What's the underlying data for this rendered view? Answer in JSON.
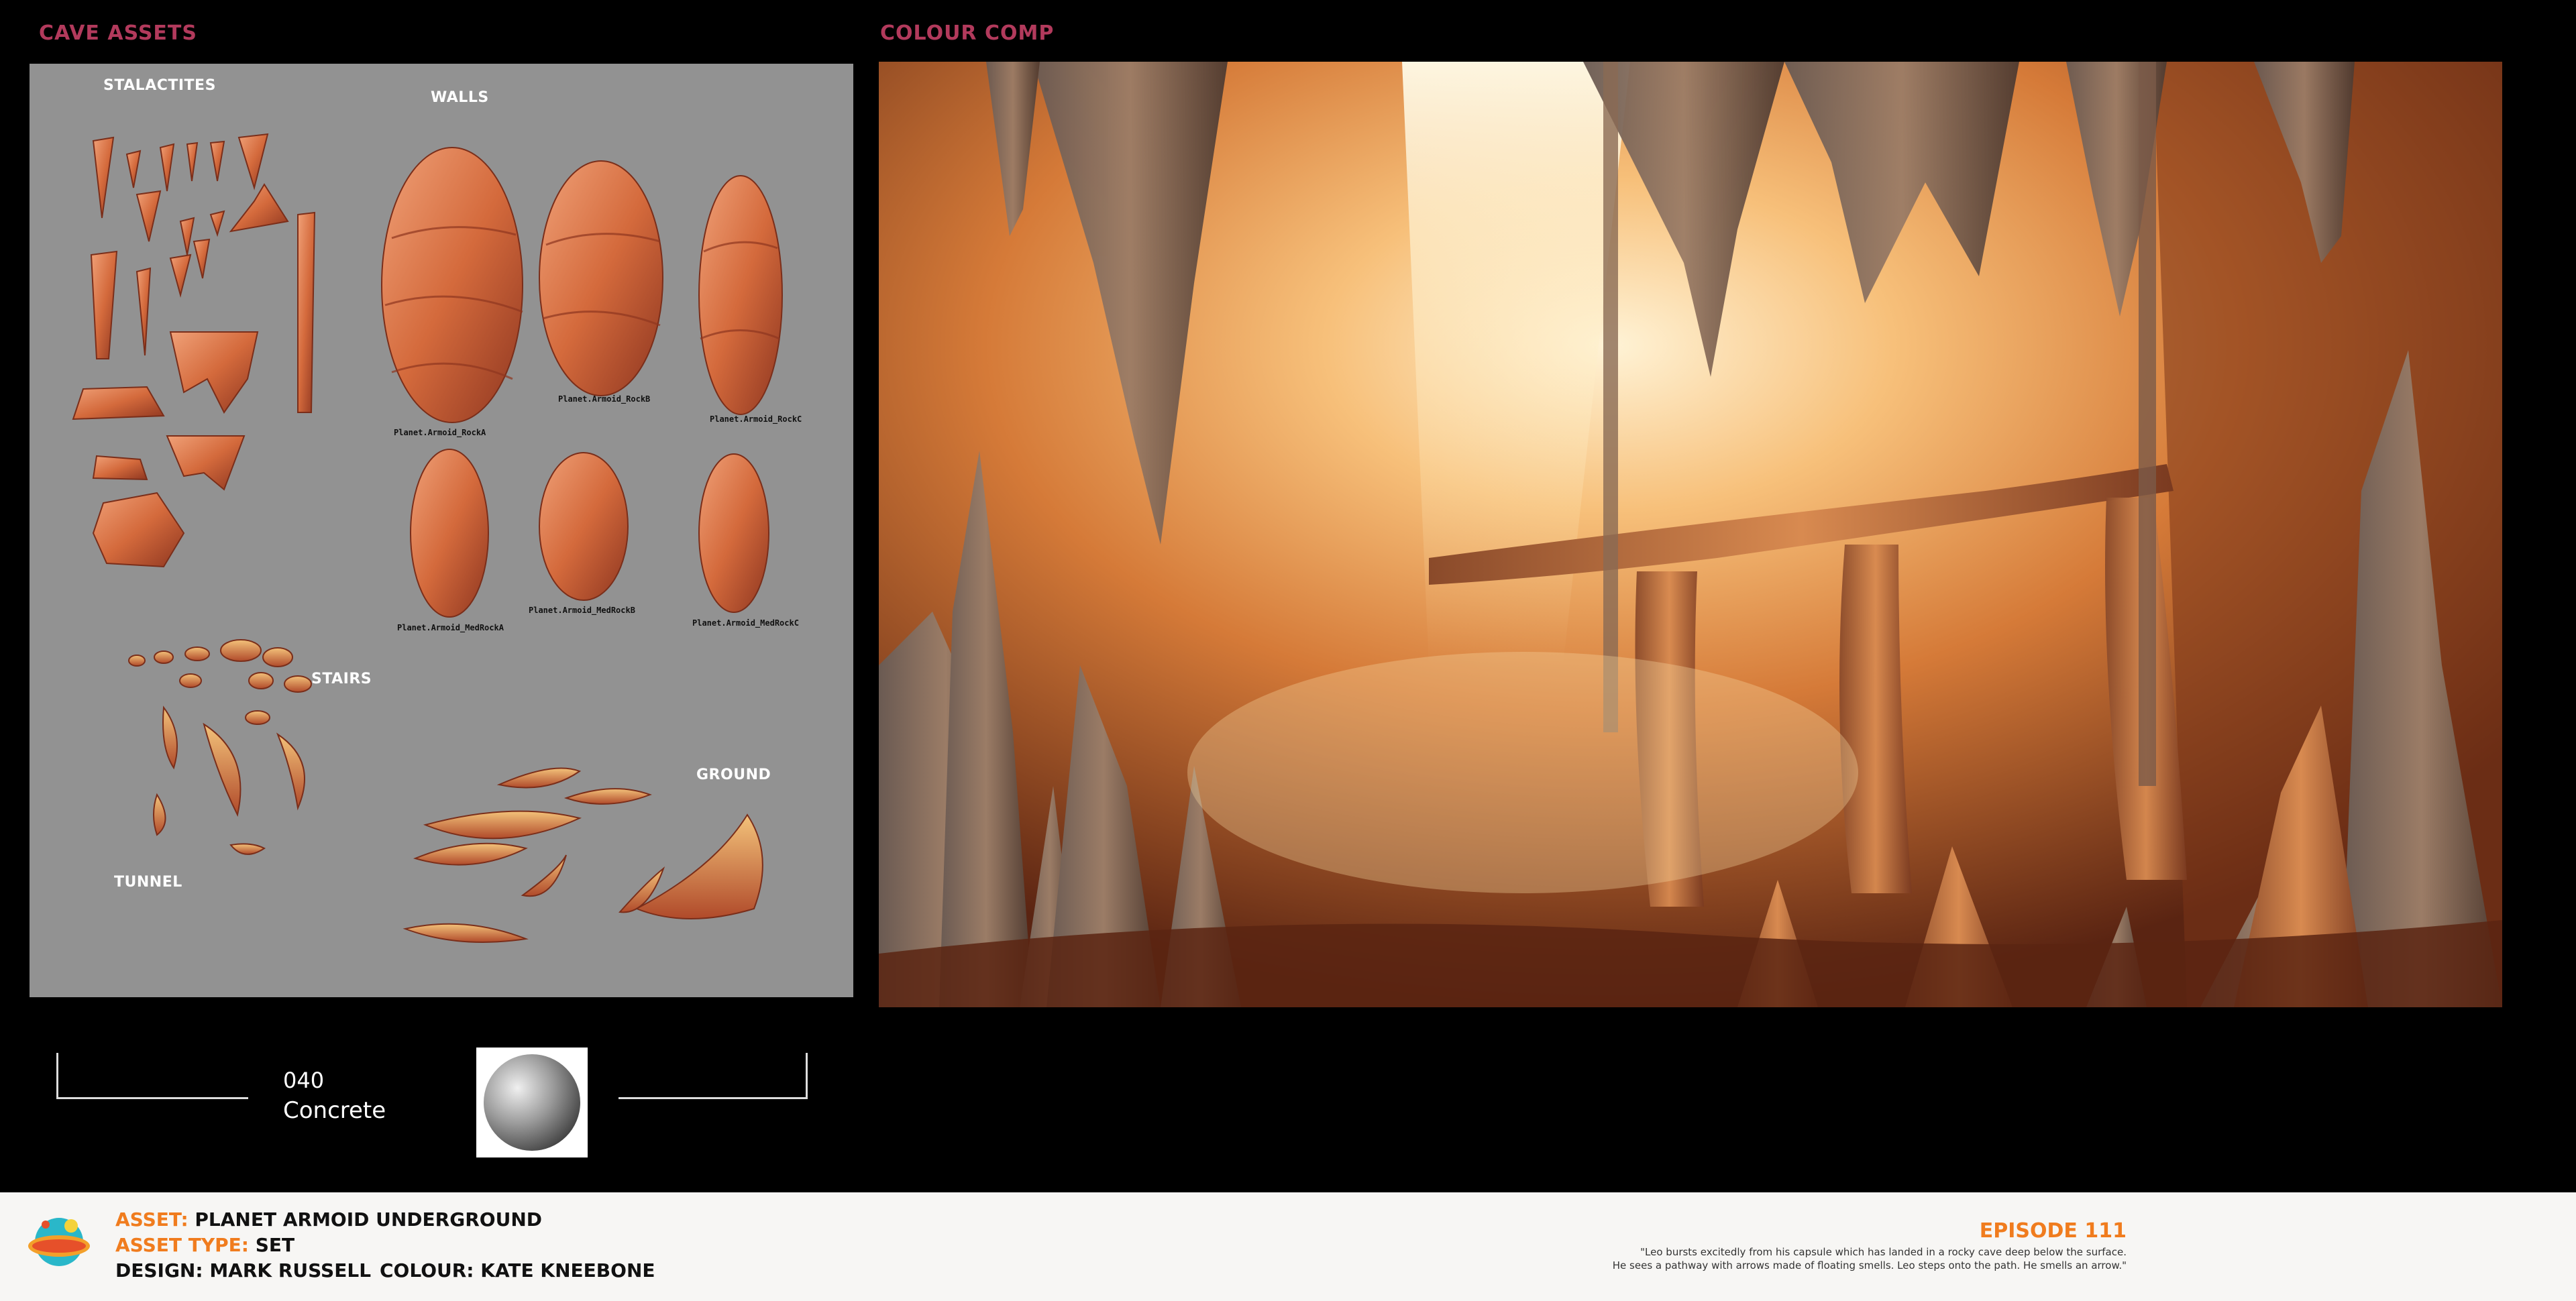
{
  "sections": {
    "assets_title": "CAVE ASSETS",
    "comp_title": "COLOUR COMP"
  },
  "asset_labels": {
    "stalactites": "STALACTITES",
    "walls": "WALLS",
    "stairs": "STAIRS",
    "tunnel": "TUNNEL",
    "ground": "GROUND"
  },
  "rock_labels": {
    "rock_a": "Planet.Armoid_RockA",
    "rock_b": "Planet.Armoid_RockB",
    "rock_c": "Planet.Armoid_RockC",
    "med_rock_a": "Planet.Armoid_MedRockA",
    "med_rock_b": "Planet.Armoid_MedRockB",
    "med_rock_c": "Planet.Armoid_MedRockC"
  },
  "material": {
    "code": "040",
    "name": "Concrete"
  },
  "footer": {
    "asset_key": "ASSET:",
    "asset_value": "PLANET ARMOID UNDERGROUND",
    "type_key": "ASSET TYPE:",
    "type_value": "SET",
    "design": "DESIGN: MARK RUSSELL",
    "colour": "COLOUR: KATE KNEEBONE",
    "episode": "EPISODE 111",
    "synopsis_1": "\"Leo bursts excitedly from his capsule which has landed in a rocky cave deep below the surface.",
    "synopsis_2": "He sees a pathway with arrows made of floating smells. Leo steps onto the path. He smells an arrow.\""
  },
  "colors": {
    "section_title": "#b23a5c",
    "accent_orange": "#f07c1e",
    "sheet_bg": "#929292"
  }
}
